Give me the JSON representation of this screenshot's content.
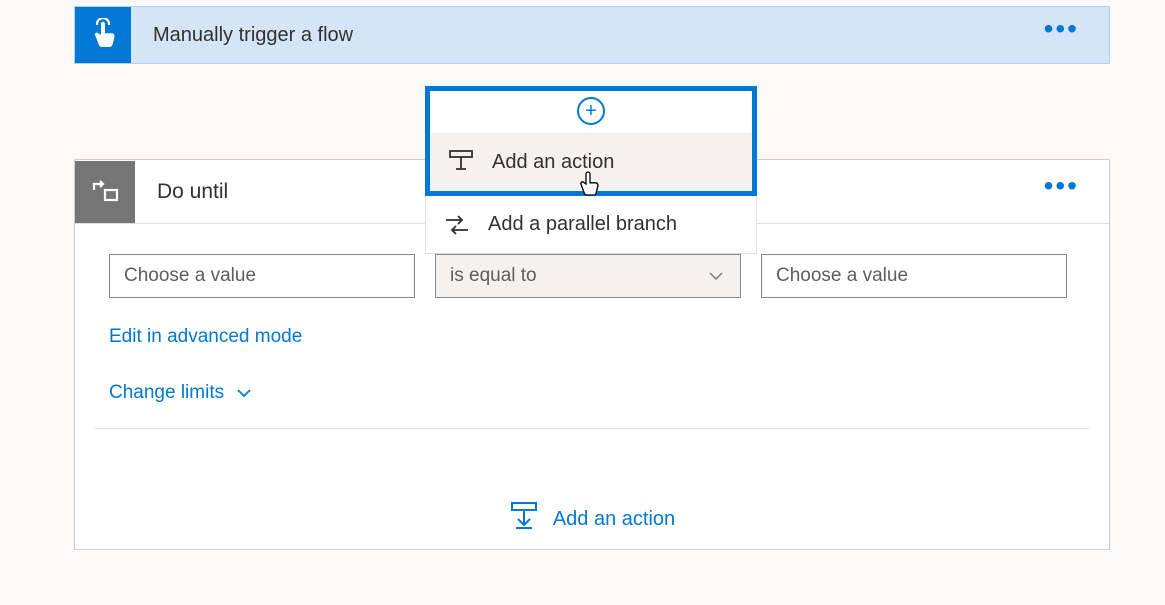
{
  "trigger": {
    "title": "Manually trigger a flow"
  },
  "insert_menu": {
    "add_action": "Add an action",
    "add_parallel": "Add a parallel branch"
  },
  "do_until": {
    "title": "Do until",
    "left_placeholder": "Choose a value",
    "operator_label": "is equal to",
    "right_placeholder": "Choose a value",
    "edit_advanced": "Edit in advanced mode",
    "change_limits": "Change limits",
    "add_action": "Add an action"
  },
  "icons": {
    "plus": "+",
    "ellipsis": "•••"
  }
}
